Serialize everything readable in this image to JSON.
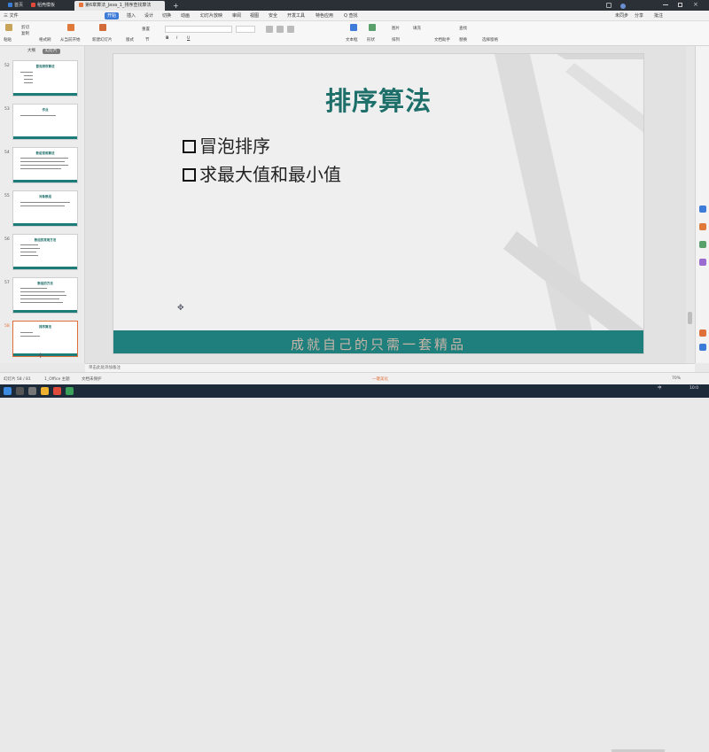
{
  "titlebar": {
    "tabs": [
      {
        "label": "首页",
        "active": false
      },
      {
        "label": "稻壳模板",
        "active": false
      },
      {
        "label": "第6章算法_Java_1_排序查找算法",
        "active": true
      }
    ],
    "new_tab": "+"
  },
  "menubar": {
    "file": "三 文件",
    "items": [
      "开始",
      "插入",
      "设计",
      "切换",
      "动画",
      "幻灯片放映",
      "审阅",
      "视图",
      "安全",
      "开发工具",
      "特色应用"
    ],
    "search": "Q 查找",
    "right": [
      "未同步",
      "分享",
      "批注"
    ]
  },
  "ribbon": {
    "paste": "粘贴",
    "cut": "剪切",
    "copy": "复制",
    "format_painter": "格式刷",
    "from_start": "从当前开始",
    "new_slide": "新建幻灯片",
    "layout": "版式",
    "section": "节",
    "reset": "重置",
    "bold": "B",
    "italic": "I",
    "underline": "U",
    "textbox": "文本框",
    "shape": "形状",
    "arrange": "排列",
    "image": "图片",
    "fill": "填充",
    "find": "查找",
    "replace": "替换",
    "text_effect": "文档助手",
    "select": "选择窗格"
  },
  "leftpanel": {
    "tabs": [
      "大纲",
      "幻灯片"
    ],
    "thumbs": [
      {
        "num": "52",
        "title": "冒泡排序算法"
      },
      {
        "num": "53",
        "title": "作业"
      },
      {
        "num": "54",
        "title": "数组常用算法"
      },
      {
        "num": "55",
        "title": "对象数组"
      },
      {
        "num": "56",
        "title": "数组的常用方法"
      },
      {
        "num": "57",
        "title": "数组的方法"
      },
      {
        "num": "58",
        "title": "排序算法"
      }
    ],
    "add": "+"
  },
  "slide": {
    "title": "排序算法",
    "bullets": [
      "冒泡排序",
      "求最大值和最小值"
    ],
    "footer": "成就自己的只需一套精品"
  },
  "notes": {
    "placeholder": "单击此处添加备注"
  },
  "statusbar": {
    "slide_count": "幻灯片 58 / 81",
    "theme": "1_Office 主题",
    "doc_protect": "文档未保护",
    "beautify": "一键美化",
    "zoom": "70%"
  },
  "taskbar": {
    "time": "10:0",
    "lang": "中"
  }
}
